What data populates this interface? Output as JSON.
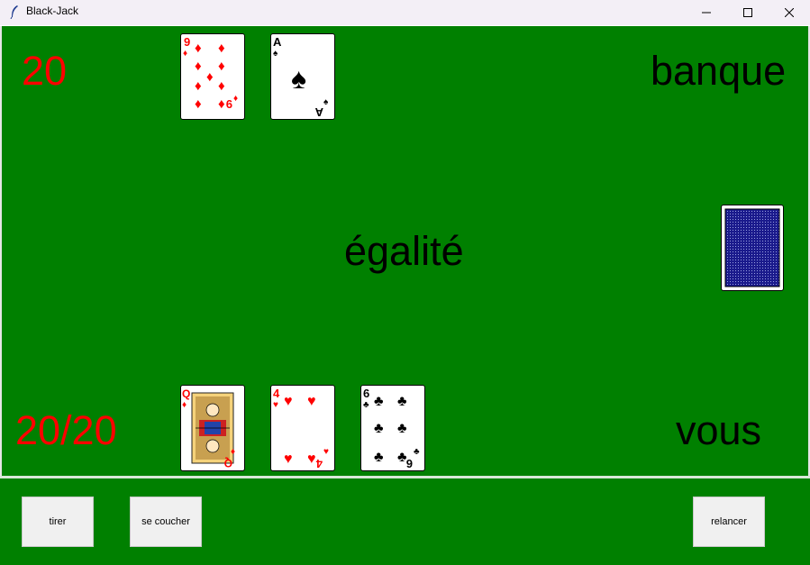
{
  "window": {
    "title": "Black-Jack"
  },
  "table": {
    "dealer_score": "20",
    "dealer_label": "banque",
    "result": "égalité",
    "player_score": "20/20",
    "player_label": "vous"
  },
  "dealer_cards": [
    {
      "rank": "9",
      "suit": "diamonds",
      "color": "#ff0000"
    },
    {
      "rank": "A",
      "suit": "spades",
      "color": "#000000"
    }
  ],
  "player_cards": [
    {
      "rank": "Q",
      "suit": "diamonds",
      "color": "#ff0000"
    },
    {
      "rank": "4",
      "suit": "hearts",
      "color": "#ff0000"
    },
    {
      "rank": "6",
      "suit": "clubs",
      "color": "#000000"
    }
  ],
  "deck": {
    "state": "face-down",
    "back_color": "#1a1a8c"
  },
  "buttons": {
    "hit": "tirer",
    "stand": "se coucher",
    "restart": "relancer"
  },
  "colors": {
    "felt": "#008000",
    "score": "#ff0000"
  }
}
